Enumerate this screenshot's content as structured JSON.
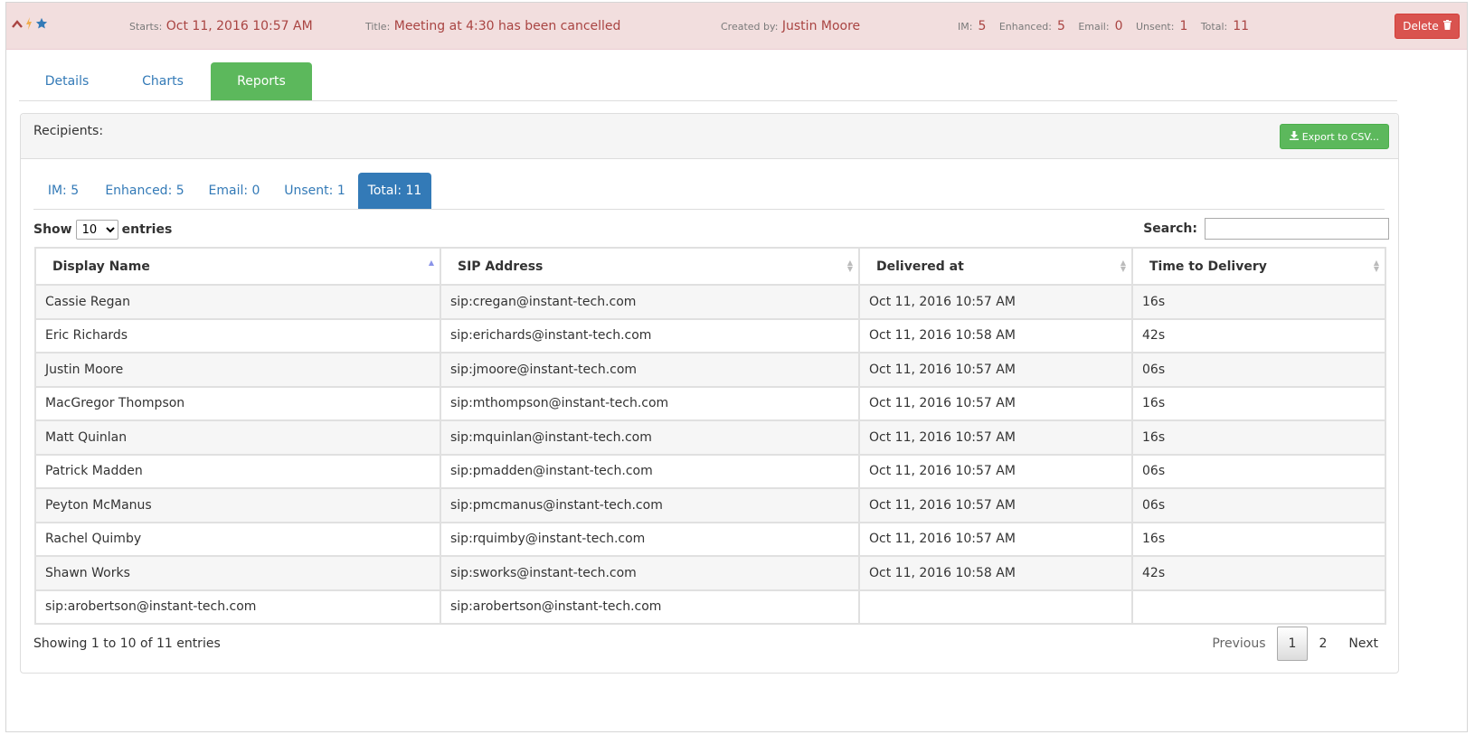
{
  "header": {
    "starts_label": "Starts:",
    "starts_value": "Oct 11, 2016 10:57 AM",
    "title_label": "Title:",
    "title_value": "Meeting at 4:30 has been cancelled",
    "created_label": "Created by:",
    "created_value": "Justin Moore",
    "counts": {
      "im_label": "IM:",
      "im": "5",
      "enh_label": "Enhanced:",
      "enh": "5",
      "email_label": "Email:",
      "email": "0",
      "unsent_label": "Unsent:",
      "unsent": "1",
      "total_label": "Total:",
      "total": "11"
    },
    "delete_label": "Delete"
  },
  "tabs": [
    {
      "label": "Details"
    },
    {
      "label": "Charts"
    },
    {
      "label": "Reports"
    }
  ],
  "panel": {
    "title": "Recipients:",
    "export_label": "Export to CSV..."
  },
  "pills": [
    {
      "label": "IM: 5"
    },
    {
      "label": "Enhanced: 5"
    },
    {
      "label": "Email: 0"
    },
    {
      "label": "Unsent: 1"
    },
    {
      "label": "Total: 11"
    }
  ],
  "length": {
    "show": "Show",
    "value": "10",
    "entries": "entries"
  },
  "search": {
    "label": "Search:",
    "value": ""
  },
  "table": {
    "columns": [
      "Display Name",
      "SIP Address",
      "Delivered at",
      "Time to Delivery"
    ],
    "rows": [
      [
        "Cassie Regan",
        "sip:cregan@instant-tech.com",
        "Oct 11, 2016 10:57 AM",
        "16s"
      ],
      [
        "Eric Richards",
        "sip:erichards@instant-tech.com",
        "Oct 11, 2016 10:58 AM",
        "42s"
      ],
      [
        "Justin Moore",
        "sip:jmoore@instant-tech.com",
        "Oct 11, 2016 10:57 AM",
        "06s"
      ],
      [
        "MacGregor Thompson",
        "sip:mthompson@instant-tech.com",
        "Oct 11, 2016 10:57 AM",
        "16s"
      ],
      [
        "Matt Quinlan",
        "sip:mquinlan@instant-tech.com",
        "Oct 11, 2016 10:57 AM",
        "16s"
      ],
      [
        "Patrick Madden",
        "sip:pmadden@instant-tech.com",
        "Oct 11, 2016 10:57 AM",
        "06s"
      ],
      [
        "Peyton McManus",
        "sip:pmcmanus@instant-tech.com",
        "Oct 11, 2016 10:57 AM",
        "06s"
      ],
      [
        "Rachel Quimby",
        "sip:rquimby@instant-tech.com",
        "Oct 11, 2016 10:57 AM",
        "16s"
      ],
      [
        "Shawn Works",
        "sip:sworks@instant-tech.com",
        "Oct 11, 2016 10:58 AM",
        "42s"
      ],
      [
        "sip:arobertson@instant-tech.com",
        "sip:arobertson@instant-tech.com",
        "",
        ""
      ]
    ]
  },
  "footer": {
    "info": "Showing 1 to 10 of 11 entries",
    "previous": "Previous",
    "pages": [
      "1",
      "2"
    ],
    "next": "Next"
  },
  "colors": {
    "header_bg": "#f2dede",
    "header_text": "#a94442",
    "active_tab": "#5cb85c",
    "active_pill": "#337ab7",
    "delete_button": "#d9534f"
  },
  "icons": [
    "chevron-up-icon",
    "bolt-icon",
    "star-icon",
    "trash-icon",
    "download-icon"
  ]
}
